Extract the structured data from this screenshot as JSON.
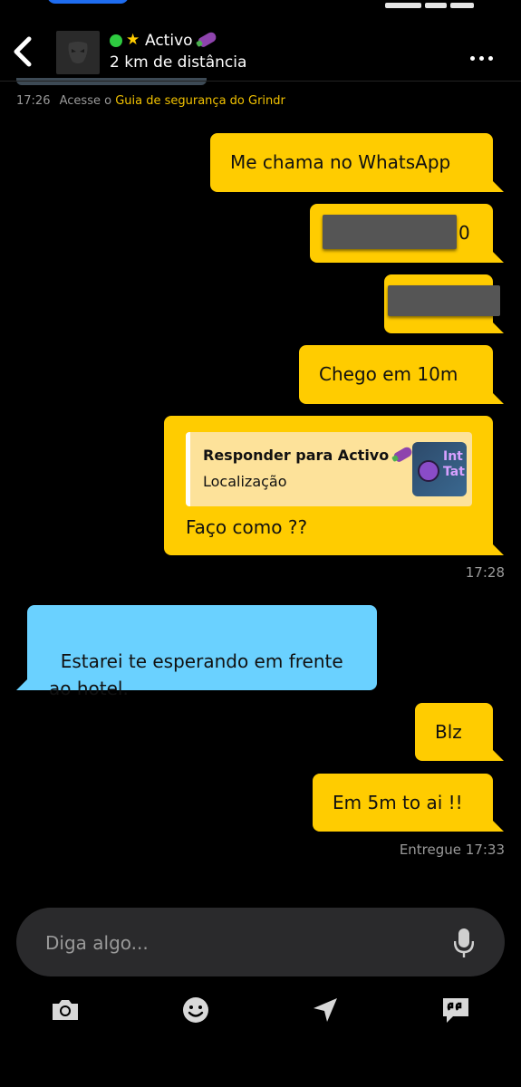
{
  "header": {
    "back_icon": "chevron-left-icon",
    "profile_name": "Activo",
    "distance": "2 km de distância",
    "more_icon": "more-dots-icon"
  },
  "system": {
    "time": "17:26",
    "prefix": "Acesse o",
    "link": "Guia de segurança do Grindr"
  },
  "messages": {
    "m1": "Me chama no WhatsApp",
    "m2_suffix": "0",
    "m3": "Chego em 10m",
    "m4": {
      "reply_title": "Responder para Activo",
      "reply_subtitle": "Localização",
      "map_text": "Int\nTat",
      "text": "Faço como ??",
      "time": "17:28"
    },
    "m5": "Estarei te esperando em frente\nao hotel.",
    "m6": "Blz",
    "m7": "Em 5m to ai !!",
    "delivery": "Entregue 17:33"
  },
  "composer": {
    "placeholder": "Diga algo..."
  },
  "toolbar": [
    "camera-icon",
    "emoji-icon",
    "location-arrow-icon",
    "quick-replies-icon"
  ],
  "colors": {
    "outgoing_bubble": "#ffcc00",
    "incoming_bubble": "#6ad1ff",
    "online": "#2ecc40",
    "link": "#f2c200",
    "background": "#000000"
  }
}
